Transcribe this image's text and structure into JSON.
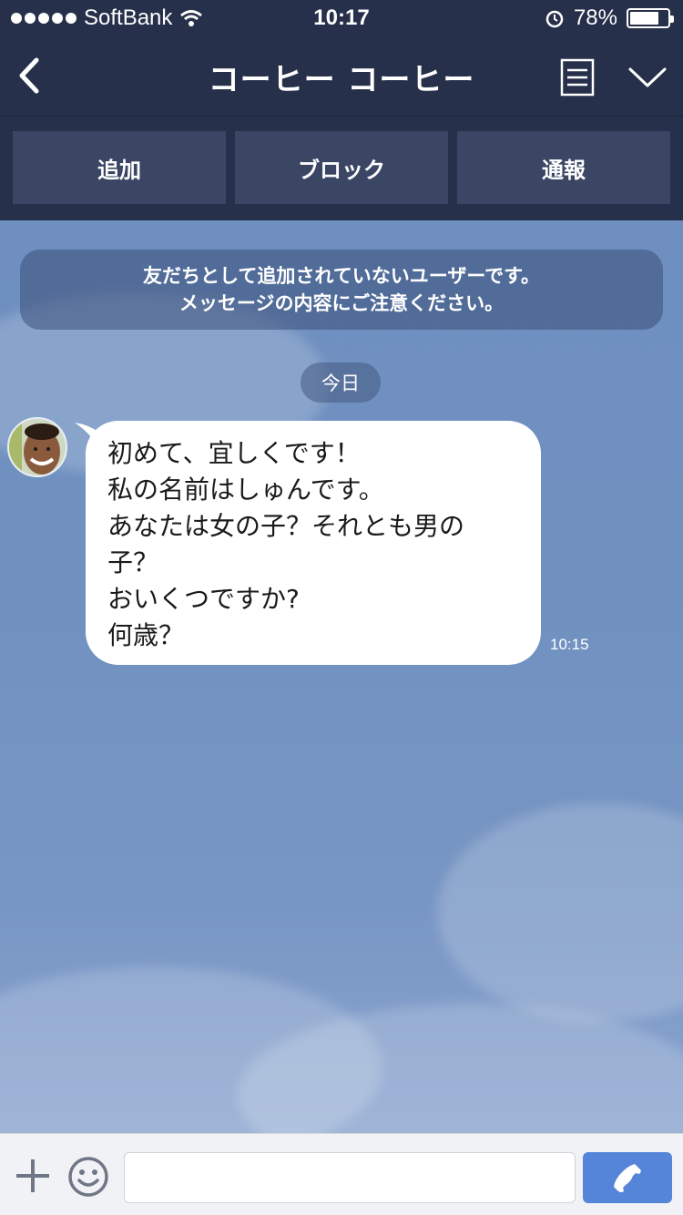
{
  "status_bar": {
    "carrier": "SoftBank",
    "time": "10:17",
    "battery_text": "78%",
    "battery_level": 0.78,
    "icons": [
      "signal-dots-icon",
      "wifi-icon",
      "alarm-icon",
      "battery-icon"
    ]
  },
  "header": {
    "title": "コーヒー コーヒー",
    "icons": [
      "back-chevron-icon",
      "menu-list-icon",
      "chevron-down-icon"
    ]
  },
  "actions": {
    "add_label": "追加",
    "block_label": "ブロック",
    "report_label": "通報"
  },
  "chat": {
    "notice_line1": "友だちとして追加されていないユーザーです。",
    "notice_line2": "メッセージの内容にご注意ください。",
    "date_label": "今日",
    "message": {
      "lines": [
        "初めて、宜しくです！",
        "私の名前はしゅんです。",
        "あなたは女の子？それとも男の",
        "子？",
        "おいくつですか?",
        "何歳？"
      ],
      "time": "10:15"
    }
  },
  "input_bar": {
    "placeholder": "",
    "icons": [
      "plus-icon",
      "emoji-icon",
      "phone-icon"
    ]
  },
  "colors": {
    "header_bg": "#27304a",
    "action_button_bg": "#3b4664",
    "chat_bg": "#7091c0",
    "call_button": "#5585d8"
  }
}
